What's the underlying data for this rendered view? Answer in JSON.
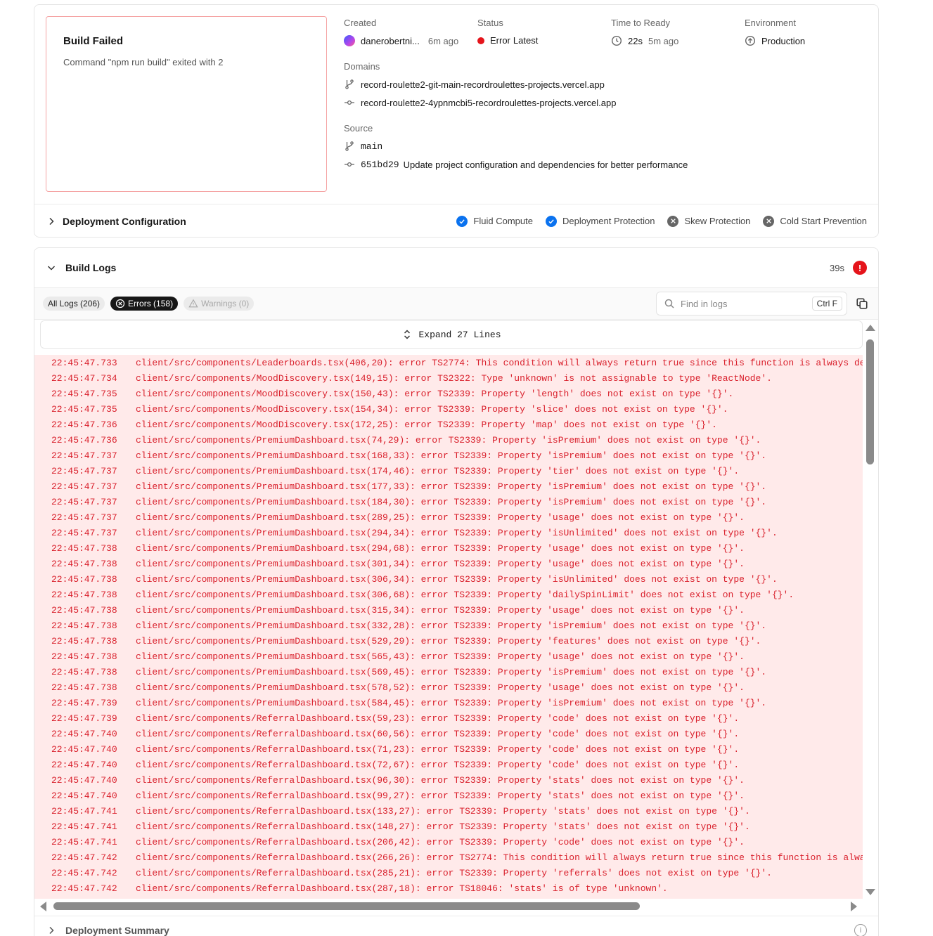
{
  "build_status": {
    "title": "Build Failed",
    "message": "Command \"npm run build\" exited with 2"
  },
  "meta": {
    "created_label": "Created",
    "created_user": "danerobertni...",
    "created_time": "6m ago",
    "status_label": "Status",
    "status_value": "Error",
    "status_tag": "Latest",
    "ready_label": "Time to Ready",
    "ready_duration": "22s",
    "ready_time": "5m ago",
    "env_label": "Environment",
    "env_value": "Production",
    "domains_label": "Domains",
    "domains": [
      "record-roulette2-git-main-recordroulettes-projects.vercel.app",
      "record-roulette2-4ypnmcbi5-recordroulettes-projects.vercel.app"
    ],
    "source_label": "Source",
    "branch": "main",
    "commit_hash": "651bd29",
    "commit_message": "Update project configuration and dependencies for better performance"
  },
  "config": {
    "title": "Deployment Configuration",
    "features": [
      {
        "label": "Fluid Compute",
        "enabled": true
      },
      {
        "label": "Deployment Protection",
        "enabled": true
      },
      {
        "label": "Skew Protection",
        "enabled": false
      },
      {
        "label": "Cold Start Prevention",
        "enabled": false
      }
    ]
  },
  "build_logs": {
    "title": "Build Logs",
    "duration": "39s",
    "filters": {
      "all": "All Logs (206)",
      "errors": "Errors (158)",
      "warnings": "Warnings (0)"
    },
    "search_placeholder": "Find in logs",
    "shortcut": "Ctrl F",
    "expand_label": "Expand 27 Lines",
    "lines": [
      {
        "ts": "22:45:47.733",
        "msg": "client/src/components/Leaderboards.tsx(406,20): error TS2774: This condition will always return true since this function is always defined."
      },
      {
        "ts": "22:45:47.734",
        "msg": "client/src/components/MoodDiscovery.tsx(149,15): error TS2322: Type 'unknown' is not assignable to type 'ReactNode'."
      },
      {
        "ts": "22:45:47.735",
        "msg": "client/src/components/MoodDiscovery.tsx(150,43): error TS2339: Property 'length' does not exist on type '{}'."
      },
      {
        "ts": "22:45:47.735",
        "msg": "client/src/components/MoodDiscovery.tsx(154,34): error TS2339: Property 'slice' does not exist on type '{}'."
      },
      {
        "ts": "22:45:47.736",
        "msg": "client/src/components/MoodDiscovery.tsx(172,25): error TS2339: Property 'map' does not exist on type '{}'."
      },
      {
        "ts": "22:45:47.736",
        "msg": "client/src/components/PremiumDashboard.tsx(74,29): error TS2339: Property 'isPremium' does not exist on type '{}'."
      },
      {
        "ts": "22:45:47.737",
        "msg": "client/src/components/PremiumDashboard.tsx(168,33): error TS2339: Property 'isPremium' does not exist on type '{}'."
      },
      {
        "ts": "22:45:47.737",
        "msg": "client/src/components/PremiumDashboard.tsx(174,46): error TS2339: Property 'tier' does not exist on type '{}'."
      },
      {
        "ts": "22:45:47.737",
        "msg": "client/src/components/PremiumDashboard.tsx(177,33): error TS2339: Property 'isPremium' does not exist on type '{}'."
      },
      {
        "ts": "22:45:47.737",
        "msg": "client/src/components/PremiumDashboard.tsx(184,30): error TS2339: Property 'isPremium' does not exist on type '{}'."
      },
      {
        "ts": "22:45:47.737",
        "msg": "client/src/components/PremiumDashboard.tsx(289,25): error TS2339: Property 'usage' does not exist on type '{}'."
      },
      {
        "ts": "22:45:47.737",
        "msg": "client/src/components/PremiumDashboard.tsx(294,34): error TS2339: Property 'isUnlimited' does not exist on type '{}'."
      },
      {
        "ts": "22:45:47.738",
        "msg": "client/src/components/PremiumDashboard.tsx(294,68): error TS2339: Property 'usage' does not exist on type '{}'."
      },
      {
        "ts": "22:45:47.738",
        "msg": "client/src/components/PremiumDashboard.tsx(301,34): error TS2339: Property 'usage' does not exist on type '{}'."
      },
      {
        "ts": "22:45:47.738",
        "msg": "client/src/components/PremiumDashboard.tsx(306,34): error TS2339: Property 'isUnlimited' does not exist on type '{}'."
      },
      {
        "ts": "22:45:47.738",
        "msg": "client/src/components/PremiumDashboard.tsx(306,68): error TS2339: Property 'dailySpinLimit' does not exist on type '{}'."
      },
      {
        "ts": "22:45:47.738",
        "msg": "client/src/components/PremiumDashboard.tsx(315,34): error TS2339: Property 'usage' does not exist on type '{}'."
      },
      {
        "ts": "22:45:47.738",
        "msg": "client/src/components/PremiumDashboard.tsx(332,28): error TS2339: Property 'isPremium' does not exist on type '{}'."
      },
      {
        "ts": "22:45:47.738",
        "msg": "client/src/components/PremiumDashboard.tsx(529,29): error TS2339: Property 'features' does not exist on type '{}'."
      },
      {
        "ts": "22:45:47.738",
        "msg": "client/src/components/PremiumDashboard.tsx(565,43): error TS2339: Property 'usage' does not exist on type '{}'."
      },
      {
        "ts": "22:45:47.738",
        "msg": "client/src/components/PremiumDashboard.tsx(569,45): error TS2339: Property 'isPremium' does not exist on type '{}'."
      },
      {
        "ts": "22:45:47.738",
        "msg": "client/src/components/PremiumDashboard.tsx(578,52): error TS2339: Property 'usage' does not exist on type '{}'."
      },
      {
        "ts": "22:45:47.739",
        "msg": "client/src/components/PremiumDashboard.tsx(584,45): error TS2339: Property 'isPremium' does not exist on type '{}'."
      },
      {
        "ts": "22:45:47.739",
        "msg": "client/src/components/ReferralDashboard.tsx(59,23): error TS2339: Property 'code' does not exist on type '{}'."
      },
      {
        "ts": "22:45:47.740",
        "msg": "client/src/components/ReferralDashboard.tsx(60,56): error TS2339: Property 'code' does not exist on type '{}'."
      },
      {
        "ts": "22:45:47.740",
        "msg": "client/src/components/ReferralDashboard.tsx(71,23): error TS2339: Property 'code' does not exist on type '{}'."
      },
      {
        "ts": "22:45:47.740",
        "msg": "client/src/components/ReferralDashboard.tsx(72,67): error TS2339: Property 'code' does not exist on type '{}'."
      },
      {
        "ts": "22:45:47.740",
        "msg": "client/src/components/ReferralDashboard.tsx(96,30): error TS2339: Property 'stats' does not exist on type '{}'."
      },
      {
        "ts": "22:45:47.740",
        "msg": "client/src/components/ReferralDashboard.tsx(99,27): error TS2339: Property 'stats' does not exist on type '{}'."
      },
      {
        "ts": "22:45:47.741",
        "msg": "client/src/components/ReferralDashboard.tsx(133,27): error TS2339: Property 'stats' does not exist on type '{}'."
      },
      {
        "ts": "22:45:47.741",
        "msg": "client/src/components/ReferralDashboard.tsx(148,27): error TS2339: Property 'stats' does not exist on type '{}'."
      },
      {
        "ts": "22:45:47.741",
        "msg": "client/src/components/ReferralDashboard.tsx(206,42): error TS2339: Property 'code' does not exist on type '{}'."
      },
      {
        "ts": "22:45:47.742",
        "msg": "client/src/components/ReferralDashboard.tsx(266,26): error TS2774: This condition will always return true since this function is always defined."
      },
      {
        "ts": "22:45:47.742",
        "msg": "client/src/components/ReferralDashboard.tsx(285,21): error TS2339: Property 'referrals' does not exist on type '{}'."
      },
      {
        "ts": "22:45:47.742",
        "msg": "client/src/components/ReferralDashboard.tsx(287,18): error TS18046: 'stats' is of type 'unknown'."
      }
    ]
  },
  "summary": {
    "title": "Deployment Summary"
  },
  "colors": {
    "error_text": "#d9202c",
    "error_bg": "#ffeaea",
    "accent_blue": "#0a72ef"
  }
}
